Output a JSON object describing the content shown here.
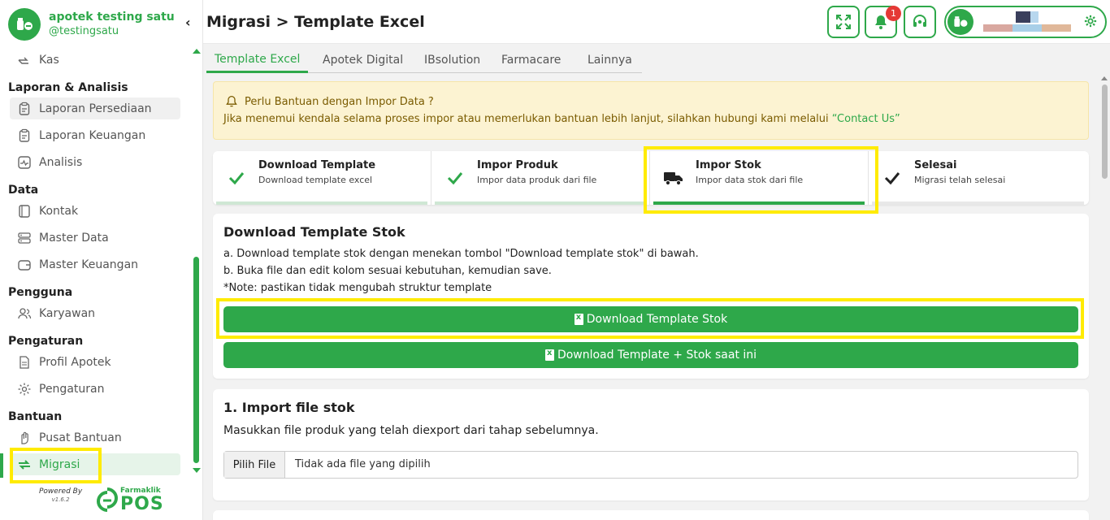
{
  "sidebar": {
    "brand_name": "apotek testing satu",
    "brand_handle": "@testingsatu",
    "collapse_icon": "chevron-left-icon",
    "items": {
      "kas": "Kas",
      "laporan_persediaan": "Laporan Persediaan",
      "laporan_keuangan": "Laporan Keuangan",
      "analisis": "Analisis",
      "kontak": "Kontak",
      "master_data": "Master Data",
      "master_keuangan": "Master Keuangan",
      "karyawan": "Karyawan",
      "profil_apotek": "Profil Apotek",
      "pengaturan": "Pengaturan",
      "pusat_bantuan": "Pusat Bantuan",
      "migrasi": "Migrasi"
    },
    "headings": {
      "laporan": "Laporan & Analisis",
      "data": "Data",
      "pengguna": "Pengguna",
      "pengaturan": "Pengaturan",
      "bantuan": "Bantuan"
    },
    "powered_by": "Powered By",
    "version": "v1.6.2",
    "logo_small": "Farmaklik",
    "logo_big": "POS"
  },
  "header": {
    "title": "Migrasi > Template Excel",
    "notification_count": "1"
  },
  "tabs": [
    "Template Excel",
    "Apotek Digital",
    "IBsolution",
    "Farmacare",
    "Lainnya"
  ],
  "alert": {
    "title": "Perlu Bantuan dengan Impor Data ?",
    "text": "Jika menemui kendala selama proses impor atau memerlukan bantuan lebih lanjut, silahkan hubungi kami melalui",
    "link": "“Contact Us”"
  },
  "steps": [
    {
      "title": "Download Template",
      "subtitle": "Download template excel"
    },
    {
      "title": "Impor Produk",
      "subtitle": "Impor data produk dari file"
    },
    {
      "title": "Impor Stok",
      "subtitle": "Impor data stok dari file"
    },
    {
      "title": "Selesai",
      "subtitle": "Migrasi telah selesai"
    }
  ],
  "download_card": {
    "title": "Download Template Stok",
    "line_a": "a. Download template stok dengan menekan tombol \"Download template stok\" di bawah.",
    "line_b": "b. Buka file dan edit kolom sesuai kebutuhan, kemudian save.",
    "note": "*Note: pastikan tidak mengubah struktur template",
    "btn_primary": "Download Template Stok",
    "btn_secondary": "Download Template + Stok saat ini"
  },
  "import_card": {
    "title": "1. Import file stok",
    "description": "Masukkan file produk yang telah diexport dari tahap sebelumnya.",
    "file_button": "Pilih File",
    "file_placeholder": "Tidak ada file yang dipilih"
  },
  "colors": {
    "primary": "#2ea84a",
    "highlight": "#ffeb00",
    "alert_bg": "#fcf3d2",
    "badge": "#e53935"
  }
}
